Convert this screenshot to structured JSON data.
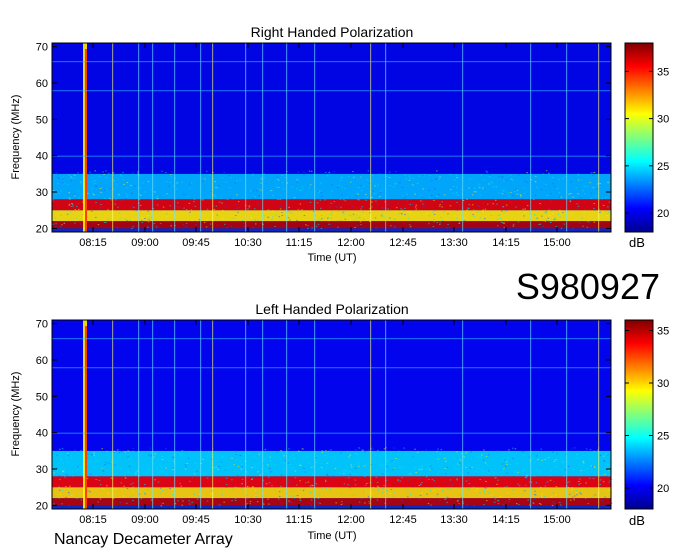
{
  "header_id": "S980927",
  "footer": "Nancay Decameter Array",
  "chart_data": [
    {
      "type": "heatmap",
      "title": "Right Handed Polarization",
      "xlabel": "Time (UT)",
      "ylabel": "Frequency (MHz)",
      "x_ticks": [
        "08:15",
        "09:00",
        "09:45",
        "10:30",
        "11:15",
        "12:00",
        "12:45",
        "13:30",
        "14:15",
        "15:00"
      ],
      "y_ticks": [
        20,
        30,
        40,
        50,
        60,
        70
      ],
      "ylim": [
        19,
        71
      ],
      "colorbar": {
        "label": "dB",
        "ticks": [
          20,
          25,
          30,
          35
        ],
        "range": [
          18,
          38
        ]
      },
      "bands": [
        {
          "freq_range_mhz": [
            20,
            22
          ],
          "level_db": 37
        },
        {
          "freq_range_mhz": [
            22,
            25
          ],
          "level_db": 31
        },
        {
          "freq_range_mhz": [
            25,
            28
          ],
          "level_db": 36
        },
        {
          "freq_range_mhz": [
            28,
            35
          ],
          "level_db": 24
        },
        {
          "freq_range_mhz": [
            35,
            71
          ],
          "level_db": 20
        }
      ]
    },
    {
      "type": "heatmap",
      "title": "Left Handed Polarization",
      "xlabel": "Time (UT)",
      "ylabel": "Frequency (MHz)",
      "x_ticks": [
        "08:15",
        "09:00",
        "09:45",
        "10:30",
        "11:15",
        "12:00",
        "12:45",
        "13:30",
        "14:15",
        "15:00"
      ],
      "y_ticks": [
        20,
        30,
        40,
        50,
        60,
        70
      ],
      "ylim": [
        19,
        71
      ],
      "colorbar": {
        "label": "dB",
        "ticks": [
          20,
          25,
          30,
          35
        ],
        "range": [
          18,
          36
        ]
      },
      "bands": [
        {
          "freq_range_mhz": [
            20,
            22
          ],
          "level_db": 35
        },
        {
          "freq_range_mhz": [
            22,
            25
          ],
          "level_db": 30
        },
        {
          "freq_range_mhz": [
            25,
            28
          ],
          "level_db": 34
        },
        {
          "freq_range_mhz": [
            28,
            35
          ],
          "level_db": 24
        },
        {
          "freq_range_mhz": [
            35,
            71
          ],
          "level_db": 20
        }
      ]
    }
  ]
}
